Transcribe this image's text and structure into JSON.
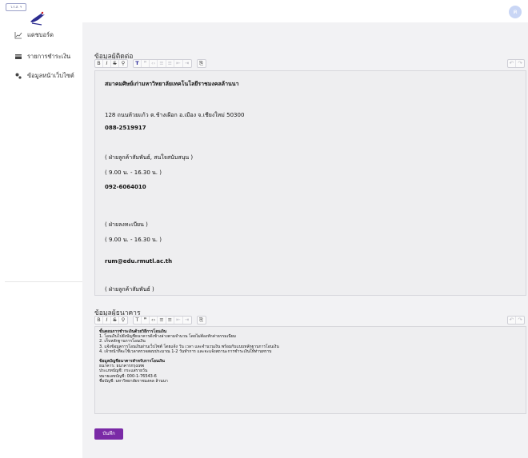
{
  "logo": {
    "badge_text": "ว.ร.ส. ฯ"
  },
  "sidebar": {
    "items": [
      {
        "label": "แดชบอร์ด",
        "icon": "chart-line-icon"
      },
      {
        "label": "รายการชำระเงิน",
        "icon": "card-icon"
      },
      {
        "label": "ข้อมูลหน้าเว็บไซต์",
        "icon": "settings-icon"
      }
    ]
  },
  "topbar": {
    "avatar_initial": "ค"
  },
  "contact": {
    "title": "ข้อมูลผู้ติดต่อ",
    "lines": [
      "สมาคมศิษย์เก่ามหาวิทยาลัยเทคโนโลยีราชมงคลล้านนา",
      "128 ถนนห้วยแก้ว ต.ช้างเผือก อ.เมือง จ.เชียงใหม่ 50300",
      "088-2519917",
      "( ฝ่ายลูกค้าสัมพันธ์, สนใจสนับสนุน )",
      "( 9.00 น. - 16.30 น. )",
      "092-6064010",
      "( ฝ่ายลงทะเบียน )",
      "( 9.00 น. - 16.30 น. )",
      "rum@edu.rmutl.ac.th",
      "( ฝ่ายลูกค้าสัมพันธ์ )"
    ]
  },
  "bank": {
    "title": "ข้อมูลผู้ธนาคาร",
    "heading": "ขั้นตอนการชำระเงินด้วยวิธีการโอนเงิน",
    "steps": [
      "1.  โอนเงินไปยังบัญชีธนาคารดังข้างล่างตามจำนวน โดยไม่ต้องหักค่าธรรมเนียม",
      "2.  เก็บหลักฐานการโอนเงิน",
      "3.  แจ้งข้อมูลการโอนเงินผ่านเว็บไซต์ โดยแจ้ง วัน เวลา และจำนวนเงิน พร้อมกับแนบหลักฐานการโอนเงิน",
      "4.  เจ้าหน้าที่จะใช้เวลาตรวจสอบประมาณ 1-2 วันทำการ และจะแจ้งสถานะการชำระเงินให้ท่านทราบ"
    ],
    "account_heading": "ข้อมูลบัญชีธนาคารสำหรับการโอนเงิน",
    "account_lines": [
      "ธนาคาร: ธนาคารกรุงเทพ",
      "ประเภทบัญชี: กระแสรายวัน",
      "หมายเลขบัญชี: 000-1-76543-6",
      "ชื่อบัญชี: มหาวิทยาลัยราชมงคล ล้านนา"
    ]
  },
  "actions": {
    "save_label": "บันทึก"
  },
  "colors": {
    "accent": "#7a2aa6",
    "editor_bg": "#eeeef0",
    "page_bg": "#f2f2f4"
  }
}
